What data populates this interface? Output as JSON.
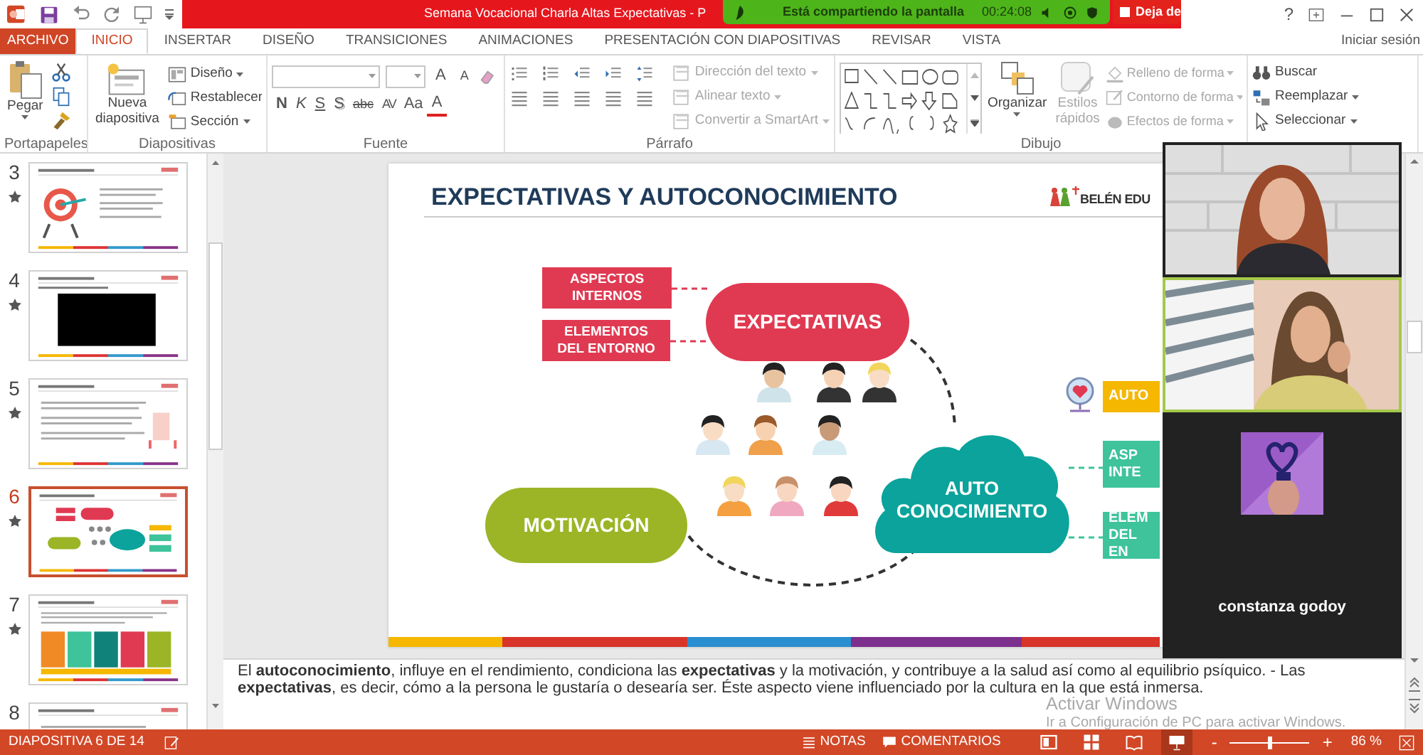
{
  "title_bar": {
    "title": "Semana Vocacional Charla Altas Expectativas - P",
    "help": "?"
  },
  "share_bar": {
    "message": "Está compartiendo la pantalla",
    "timer": "00:24:08",
    "stop_button": "Deja de"
  },
  "tabs": [
    {
      "label": "ARCHIVO",
      "kind": "file",
      "selected": false
    },
    {
      "label": "INICIO",
      "kind": "tab",
      "selected": true
    },
    {
      "label": "INSERTAR",
      "kind": "tab",
      "selected": false
    },
    {
      "label": "DISEÑO",
      "kind": "tab",
      "selected": false
    },
    {
      "label": "TRANSICIONES",
      "kind": "tab",
      "selected": false
    },
    {
      "label": "ANIMACIONES",
      "kind": "tab",
      "selected": false
    },
    {
      "label": "PRESENTACIÓN CON DIAPOSITIVAS",
      "kind": "tab",
      "selected": false
    },
    {
      "label": "REVISAR",
      "kind": "tab",
      "selected": false
    },
    {
      "label": "VISTA",
      "kind": "tab",
      "selected": false
    }
  ],
  "account": "Iniciar sesión",
  "ribbon": [
    {
      "kind": "clipboard",
      "label": "Portapapeles",
      "paste": "Pegar"
    },
    {
      "kind": "slides",
      "label": "Diapositivas",
      "new_slide": "Nueva diapositiva",
      "items": [
        {
          "label": "Diseño",
          "dropdown": true
        },
        {
          "label": "Restablecer",
          "dropdown": false
        },
        {
          "label": "Sección",
          "dropdown": true
        }
      ]
    },
    {
      "kind": "font",
      "label": "Fuente",
      "size_buttons": [
        "A",
        "A"
      ],
      "format_buttons": [
        "N",
        "K",
        "S",
        "S",
        "abc",
        "AV",
        "Aa",
        "A"
      ]
    },
    {
      "kind": "paragraph",
      "label": "Párrafo",
      "items": [
        {
          "label": "Dirección del texto",
          "disabled": true
        },
        {
          "label": "Alinear texto",
          "disabled": true
        },
        {
          "label": "Convertir a SmartArt",
          "disabled": true
        }
      ]
    },
    {
      "kind": "drawing",
      "label": "Dibujo",
      "arrange": "Organizar",
      "quick_styles": {
        "label": "Estilos rápidos",
        "disabled": true
      },
      "items": [
        {
          "label": "Relleno de forma",
          "disabled": true
        },
        {
          "label": "Contorno de forma",
          "disabled": true
        },
        {
          "label": "Efectos de forma",
          "disabled": true
        }
      ]
    },
    {
      "kind": "editing",
      "items": [
        {
          "label": "Buscar",
          "dropdown": false
        },
        {
          "label": "Reemplazar",
          "dropdown": true
        },
        {
          "label": "Seleccionar",
          "dropdown": true
        }
      ]
    }
  ],
  "thumbnails": [
    {
      "number": "3",
      "kind": "target",
      "animated": true,
      "selected": false
    },
    {
      "number": "4",
      "kind": "video",
      "animated": true,
      "selected": false
    },
    {
      "number": "5",
      "kind": "text",
      "animated": true,
      "selected": false
    },
    {
      "number": "6",
      "kind": "diagram",
      "animated": true,
      "selected": true
    },
    {
      "number": "7",
      "kind": "table",
      "animated": true,
      "selected": false
    },
    {
      "number": "8",
      "kind": "text",
      "selected": false
    }
  ],
  "slide": {
    "title": "EXPECTATIVAS Y AUTOCONOCIMIENTO",
    "logo": "BELÉN EDU",
    "nodes": [
      {
        "kind": "box",
        "text": "ASPECTOS\nINTERNOS",
        "color": "#e03a52"
      },
      {
        "kind": "box",
        "text": "ELEMENTOS\nDEL ENTORNO",
        "color": "#e03a52"
      },
      {
        "kind": "pill",
        "text": "EXPECTATIVAS",
        "color": "#e03a52"
      },
      {
        "kind": "pill",
        "text": "MOTIVACIÓN",
        "color": "#9bb526"
      },
      {
        "kind": "cloud",
        "text": "AUTO\nCONOCIMIENTO",
        "color": "#0ba39b"
      },
      {
        "kind": "box",
        "text": "AUTO",
        "color": "#f5b700"
      },
      {
        "kind": "box",
        "text": "ASP\nINTE",
        "color": "#3ec39b"
      },
      {
        "kind": "box",
        "text": "ELEM\nDEL EN",
        "color": "#3ec39b"
      }
    ]
  },
  "notes": "El **autoconocimiento**, influye en el rendimiento, condiciona las **expectativas** y la motivación, y contribuye a la salud así como al equilibrio psíquico. - Las **expectativas**, es decir, cómo a la persona le gustaría o desearía ser. Éste aspecto viene influenciado por la cultura en la que está inmersa.",
  "activation_notice": {
    "title": "Activar Windows",
    "text": "Ir a Configuración de PC para activar Windows."
  },
  "video_call": {
    "tiles": [
      {
        "kind": "video",
        "speaking": false
      },
      {
        "kind": "video",
        "speaking": true
      },
      {
        "kind": "avatar",
        "name": "constanza godoy"
      }
    ]
  },
  "status_bar": {
    "slide_counter": "DIAPOSITIVA 6 DE 14",
    "notes_button": "NOTAS",
    "comments_button": "COMENTARIOS",
    "views": [
      {
        "selected": false
      },
      {
        "selected": false
      },
      {
        "selected": false
      },
      {
        "selected": true
      }
    ],
    "zoom": {
      "minus": "-",
      "plus": "+",
      "level": 0.5,
      "value": "86 %"
    }
  }
}
